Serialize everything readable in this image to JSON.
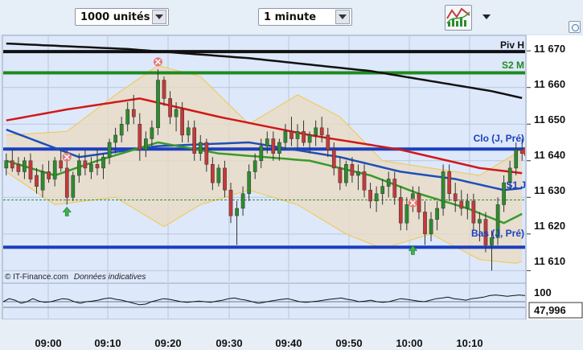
{
  "toolbar": {
    "quantity_selector": {
      "value": "1000 unités"
    },
    "interval_selector": {
      "value": "1 minute"
    },
    "indicator_tool": {
      "icon": "chart-indicators-icon"
    }
  },
  "price_axis": {
    "labels": [
      "11 670",
      "11 660",
      "11 650",
      "11 640",
      "11 630",
      "11 620",
      "11 610"
    ]
  },
  "time_axis": {
    "labels": [
      "09:00",
      "09:10",
      "09:20",
      "09:30",
      "09:40",
      "09:50",
      "10:00",
      "10:10"
    ]
  },
  "pivot_labels": {
    "piv_h": "Piv H",
    "s2_m": "S2 M",
    "clo": "Clo (J, Pré)",
    "s1": "S1 J",
    "bas": "Bas (J, Pré)"
  },
  "watermark": {
    "source": "© IT-Finance.com",
    "note": "Données indicatives"
  },
  "oscillator": {
    "top_label": "100",
    "current_value": "47,996"
  },
  "colors": {
    "candle_up": "#2e8b2e",
    "candle_down": "#c43a3a",
    "ma_red": "#d01818",
    "ma_blue": "#1f4fb8",
    "ma_green": "#3a9a2a",
    "ma_black": "#111111",
    "pivot_blue": "#1c3fbf",
    "pivot_green": "#1f8a1f",
    "bollinger_fill": "#eadbc0",
    "bollinger_edge": "#f1c84a"
  },
  "chart_data": {
    "type": "candlestick",
    "x_labels": [
      "09:00",
      "09:10",
      "09:20",
      "09:30",
      "09:40",
      "09:50",
      "10:00",
      "10:10"
    ],
    "ylim": [
      11607,
      11674
    ],
    "pivot_levels": [
      {
        "name": "Piv H",
        "value": 11669.8
      },
      {
        "name": "S2 M",
        "value": 11664.0
      },
      {
        "name": "Clo (J, Pré)",
        "value": 11643.2
      },
      {
        "name": "S1 J",
        "value": 11629.3
      },
      {
        "name": "Bas (J, Pré)",
        "value": 11616.4
      }
    ],
    "last_price": 11642.5,
    "candles": [
      [
        11638,
        11642,
        11636,
        11640
      ],
      [
        11640,
        11643,
        11637,
        11638
      ],
      [
        11639,
        11641,
        11636,
        11637
      ],
      [
        11637,
        11641,
        11635,
        11640
      ],
      [
        11640,
        11642,
        11634,
        11635
      ],
      [
        11636,
        11638,
        11631,
        11633
      ],
      [
        11632,
        11639,
        11630,
        11637
      ],
      [
        11637,
        11640,
        11634,
        11635
      ],
      [
        11635,
        11641,
        11633,
        11640
      ],
      [
        11640,
        11643,
        11637,
        11638
      ],
      [
        11638,
        11643,
        11628,
        11630
      ],
      [
        11630,
        11637,
        11629,
        11636
      ],
      [
        11636,
        11642,
        11634,
        11640
      ],
      [
        11640,
        11643,
        11636,
        11638
      ],
      [
        11637,
        11641,
        11635,
        11639
      ],
      [
        11639,
        11643,
        11636,
        11638
      ],
      [
        11638,
        11642,
        11635,
        11641
      ],
      [
        11641,
        11646,
        11639,
        11645
      ],
      [
        11645,
        11649,
        11642,
        11647
      ],
      [
        11647,
        11652,
        11645,
        11650
      ],
      [
        11650,
        11656,
        11648,
        11654
      ],
      [
        11654,
        11658,
        11650,
        11652
      ],
      [
        11650,
        11653,
        11640,
        11643
      ],
      [
        11643,
        11648,
        11641,
        11646
      ],
      [
        11646,
        11651,
        11644,
        11649
      ],
      [
        11649,
        11665,
        11647,
        11662
      ],
      [
        11662,
        11663,
        11655,
        11657
      ],
      [
        11657,
        11659,
        11650,
        11652
      ],
      [
        11652,
        11656,
        11648,
        11654
      ],
      [
        11654,
        11656,
        11645,
        11647
      ],
      [
        11647,
        11651,
        11645,
        11649
      ],
      [
        11649,
        11651,
        11640,
        11642
      ],
      [
        11642,
        11647,
        11640,
        11645
      ],
      [
        11645,
        11646,
        11637,
        11639
      ],
      [
        11639,
        11641,
        11632,
        11634
      ],
      [
        11634,
        11639,
        11633,
        11638
      ],
      [
        11638,
        11640,
        11630,
        11632
      ],
      [
        11632,
        11634,
        11623,
        11625
      ],
      [
        11625,
        11629,
        11617,
        11627
      ],
      [
        11627,
        11633,
        11625,
        11631
      ],
      [
        11631,
        11639,
        11629,
        11637
      ],
      [
        11637,
        11642,
        11635,
        11640
      ],
      [
        11640,
        11646,
        11638,
        11644
      ],
      [
        11644,
        11648,
        11642,
        11646
      ],
      [
        11646,
        11648,
        11640,
        11642
      ],
      [
        11642,
        11646,
        11640,
        11645
      ],
      [
        11645,
        11650,
        11643,
        11648
      ],
      [
        11648,
        11652,
        11644,
        11646
      ],
      [
        11646,
        11650,
        11643,
        11648
      ],
      [
        11648,
        11651,
        11644,
        11645
      ],
      [
        11645,
        11648,
        11642,
        11647
      ],
      [
        11647,
        11651,
        11644,
        11649
      ],
      [
        11649,
        11652,
        11645,
        11647
      ],
      [
        11647,
        11649,
        11641,
        11643
      ],
      [
        11643,
        11645,
        11636,
        11638
      ],
      [
        11638,
        11641,
        11632,
        11634
      ],
      [
        11634,
        11640,
        11633,
        11639
      ],
      [
        11639,
        11641,
        11634,
        11636
      ],
      [
        11636,
        11639,
        11632,
        11637
      ],
      [
        11637,
        11639,
        11630,
        11632
      ],
      [
        11632,
        11634,
        11627,
        11629
      ],
      [
        11629,
        11633,
        11626,
        11631
      ],
      [
        11631,
        11635,
        11628,
        11633
      ],
      [
        11633,
        11637,
        11630,
        11635
      ],
      [
        11635,
        11637,
        11628,
        11630
      ],
      [
        11630,
        11633,
        11621,
        11623
      ],
      [
        11623,
        11630,
        11621,
        11628
      ],
      [
        11628,
        11633,
        11626,
        11631
      ],
      [
        11631,
        11633,
        11624,
        11626
      ],
      [
        11626,
        11629,
        11617,
        11620
      ],
      [
        11620,
        11626,
        11618,
        11624
      ],
      [
        11624,
        11629,
        11621,
        11627
      ],
      [
        11627,
        11639,
        11625,
        11637
      ],
      [
        11637,
        11639,
        11629,
        11631
      ],
      [
        11631,
        11634,
        11626,
        11629
      ],
      [
        11629,
        11632,
        11625,
        11627
      ],
      [
        11627,
        11631,
        11624,
        11629
      ],
      [
        11629,
        11631,
        11621,
        11623
      ],
      [
        11623,
        11626,
        11618,
        11624
      ],
      [
        11624,
        11626,
        11615,
        11617
      ],
      [
        11617,
        11621,
        11610,
        11619
      ],
      [
        11619,
        11630,
        11617,
        11628
      ],
      [
        11628,
        11636,
        11626,
        11634
      ],
      [
        11634,
        11640,
        11632,
        11638
      ],
      [
        11638,
        11645,
        11636,
        11643
      ],
      [
        11643,
        11646,
        11640,
        11642
      ]
    ],
    "overlays": {
      "ma_black": [
        [
          0,
          11672
        ],
        [
          20,
          11670.5
        ],
        [
          40,
          11668
        ],
        [
          60,
          11664.5
        ],
        [
          80,
          11659
        ],
        [
          88,
          11656
        ]
      ],
      "ma_red": [
        [
          0,
          11651
        ],
        [
          10,
          11654
        ],
        [
          22,
          11657
        ],
        [
          35,
          11652
        ],
        [
          50,
          11647
        ],
        [
          65,
          11643
        ],
        [
          78,
          11638
        ],
        [
          88,
          11636
        ]
      ],
      "ma_blue": [
        [
          0,
          11648.5
        ],
        [
          12,
          11641
        ],
        [
          25,
          11644
        ],
        [
          40,
          11645
        ],
        [
          55,
          11641
        ],
        [
          65,
          11637
        ],
        [
          74,
          11635
        ],
        [
          82,
          11632
        ],
        [
          88,
          11633
        ]
      ],
      "ma_green": [
        [
          0,
          11640
        ],
        [
          8,
          11636
        ],
        [
          15,
          11640
        ],
        [
          25,
          11645
        ],
        [
          35,
          11642
        ],
        [
          50,
          11640
        ],
        [
          60,
          11636
        ],
        [
          68,
          11631
        ],
        [
          76,
          11627
        ],
        [
          82,
          11623
        ],
        [
          88,
          11628
        ]
      ],
      "bb_upper": [
        [
          0,
          11647
        ],
        [
          10,
          11648
        ],
        [
          18,
          11658
        ],
        [
          25,
          11666
        ],
        [
          32,
          11663
        ],
        [
          40,
          11650
        ],
        [
          48,
          11658
        ],
        [
          55,
          11652
        ],
        [
          62,
          11640
        ],
        [
          70,
          11638
        ],
        [
          78,
          11636
        ],
        [
          84,
          11642
        ],
        [
          88,
          11648
        ]
      ],
      "bb_lower": [
        [
          0,
          11637
        ],
        [
          8,
          11628
        ],
        [
          18,
          11630
        ],
        [
          26,
          11622
        ],
        [
          32,
          11628
        ],
        [
          40,
          11632
        ],
        [
          48,
          11628
        ],
        [
          56,
          11620
        ],
        [
          62,
          11616
        ],
        [
          70,
          11620
        ],
        [
          78,
          11613
        ],
        [
          84,
          11612
        ],
        [
          88,
          11614
        ]
      ]
    },
    "markers": [
      {
        "type": "sell",
        "candle": 25,
        "value": 11667
      },
      {
        "type": "sell",
        "candle": 10,
        "value": 11641
      },
      {
        "type": "sell",
        "candle": 67,
        "value": 11628.5
      },
      {
        "type": "buy",
        "candle": 10,
        "value": 11626
      },
      {
        "type": "buy",
        "candle": 67,
        "value": 11615.5
      }
    ],
    "oscillator_series": [
      0.5,
      0.6,
      0.55,
      0.45,
      0.5,
      0.6,
      0.52,
      0.48,
      0.5,
      0.55,
      0.6,
      0.58,
      0.5,
      0.45,
      0.5,
      0.52,
      0.55,
      0.6,
      0.62,
      0.58,
      0.55,
      0.5,
      0.45,
      0.4,
      0.42,
      0.5,
      0.55,
      0.6,
      0.58,
      0.54,
      0.5,
      0.48,
      0.5,
      0.52,
      0.5,
      0.48,
      0.52,
      0.55,
      0.6,
      0.62,
      0.58,
      0.55,
      0.5,
      0.45,
      0.48,
      0.52,
      0.55,
      0.58,
      0.6,
      0.55,
      0.5,
      0.48,
      0.5,
      0.52,
      0.55,
      0.58,
      0.6,
      0.62,
      0.58,
      0.55,
      0.5,
      0.52,
      0.55,
      0.5,
      0.48,
      0.5,
      0.55,
      0.6,
      0.58,
      0.55,
      0.52,
      0.5,
      0.55,
      0.6,
      0.62,
      0.65,
      0.6,
      0.58,
      0.55,
      0.6,
      0.62,
      0.65,
      0.7,
      0.72,
      0.7,
      0.68,
      0.7,
      0.72,
      0.7
    ]
  }
}
